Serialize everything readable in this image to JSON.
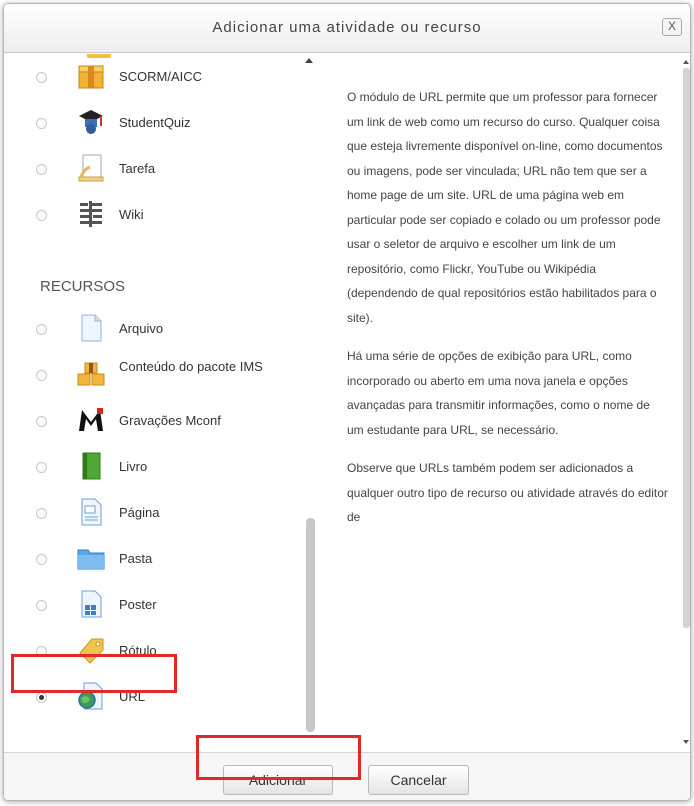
{
  "dialog": {
    "title": "Adicionar uma atividade ou recurso",
    "close_label": "X"
  },
  "activities": [
    {
      "label": "SCORM/AICC",
      "icon": "scorm-package-icon"
    },
    {
      "label": "StudentQuiz",
      "icon": "studentquiz-icon"
    },
    {
      "label": "Tarefa",
      "icon": "assignment-icon"
    },
    {
      "label": "Wiki",
      "icon": "wiki-icon"
    }
  ],
  "resources_heading": "RECURSOS",
  "resources": [
    {
      "label": "Arquivo",
      "icon": "file-icon"
    },
    {
      "label": "Conteúdo do pacote IMS",
      "icon": "ims-package-icon"
    },
    {
      "label": "Gravações Mconf",
      "icon": "mconf-icon"
    },
    {
      "label": "Livro",
      "icon": "book-icon"
    },
    {
      "label": "Página",
      "icon": "page-icon"
    },
    {
      "label": "Pasta",
      "icon": "folder-icon"
    },
    {
      "label": "Poster",
      "icon": "poster-icon"
    },
    {
      "label": "Rótulo",
      "icon": "label-tag-icon"
    },
    {
      "label": "URL",
      "icon": "url-globe-icon",
      "selected": true
    }
  ],
  "description": [
    "O módulo de URL permite que um professor para fornecer um link de web como um recurso do curso. Qualquer coisa que esteja livremente disponível on-line, como documentos ou imagens, pode ser vinculada; URL não tem que ser a home page de um site. URL de uma página web em particular pode ser copiado e colado ou um professor pode usar o seletor de arquivo e escolher um link de um repositório, como Flickr, YouTube ou Wikipédia (dependendo de qual repositórios estão habilitados para o site).",
    "Há uma série de opções de exibição para URL, como incorporado ou aberto em uma nova janela e opções avançadas para transmitir informações, como o nome de um estudante para URL, se necessário.",
    "Observe que URLs também podem ser adicionados a qualquer outro tipo de recurso ou atividade através do editor de"
  ],
  "buttons": {
    "add": "Adicionar",
    "cancel": "Cancelar"
  },
  "colors": {
    "highlight": "#e02a2a"
  }
}
